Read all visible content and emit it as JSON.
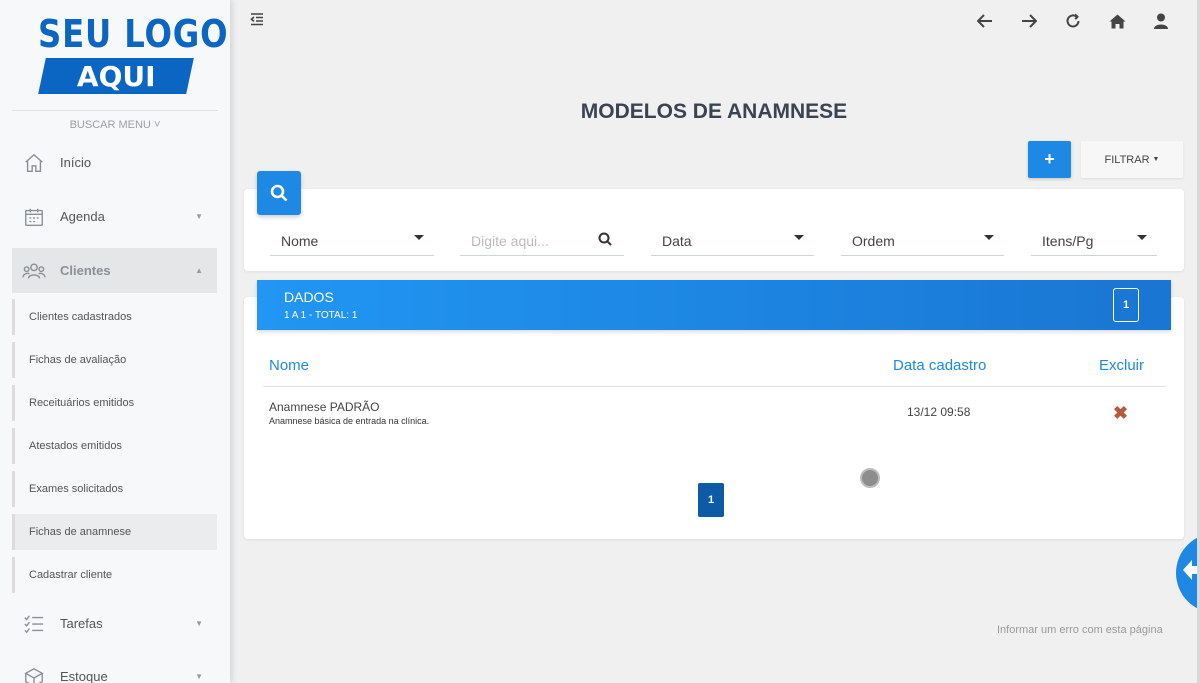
{
  "brand": {
    "logo_line1": "SEU LOGO",
    "logo_line2": "AQUI"
  },
  "sidebar": {
    "search_menu": "BUSCAR MENU",
    "items": [
      {
        "label": "Início",
        "icon": "home-icon"
      },
      {
        "label": "Agenda",
        "icon": "calendar-icon"
      },
      {
        "label": "Clientes",
        "icon": "users-icon"
      },
      {
        "label": "Tarefas",
        "icon": "tasks-icon"
      },
      {
        "label": "Estoque",
        "icon": "box-icon"
      }
    ],
    "clientes_sub": [
      "Clientes cadastrados",
      "Fichas de avaliação",
      "Receituários emitidos",
      "Atestados emitidos",
      "Exames solicitados",
      "Fichas de anamnese",
      "Cadastrar cliente"
    ]
  },
  "header": {
    "icons": [
      "back-arrow-icon",
      "forward-arrow-icon",
      "refresh-icon",
      "home-icon",
      "user-icon"
    ]
  },
  "page": {
    "title": "MODELOS DE ANAMNESE"
  },
  "toolbar": {
    "add_label": "+",
    "filter_label": "FILTRAR"
  },
  "filters": {
    "field_select": "Nome",
    "search_placeholder": "Digite aqui...",
    "date_select": "Data",
    "order_select": "Ordem",
    "per_page_select": "Itens/Pg"
  },
  "data": {
    "header_title": "DADOS",
    "header_subtitle": "1 A 1 - TOTAL: 1",
    "page_badge": "1",
    "columns": [
      "Nome",
      "Data cadastro",
      "Excluir"
    ],
    "rows": [
      {
        "name": "Anamnese PADRÃO",
        "description": "Anamnese básica de entrada na clínica.",
        "date": "13/12 09:58",
        "delete": "✖"
      }
    ],
    "pagination": "1"
  },
  "footer": {
    "report_link": "Informar um erro com esta página"
  },
  "colors": {
    "primary": "#1e88e5",
    "dark_primary": "#0d5aa7",
    "title": "#3a4354",
    "delete": "#b55a3c"
  }
}
